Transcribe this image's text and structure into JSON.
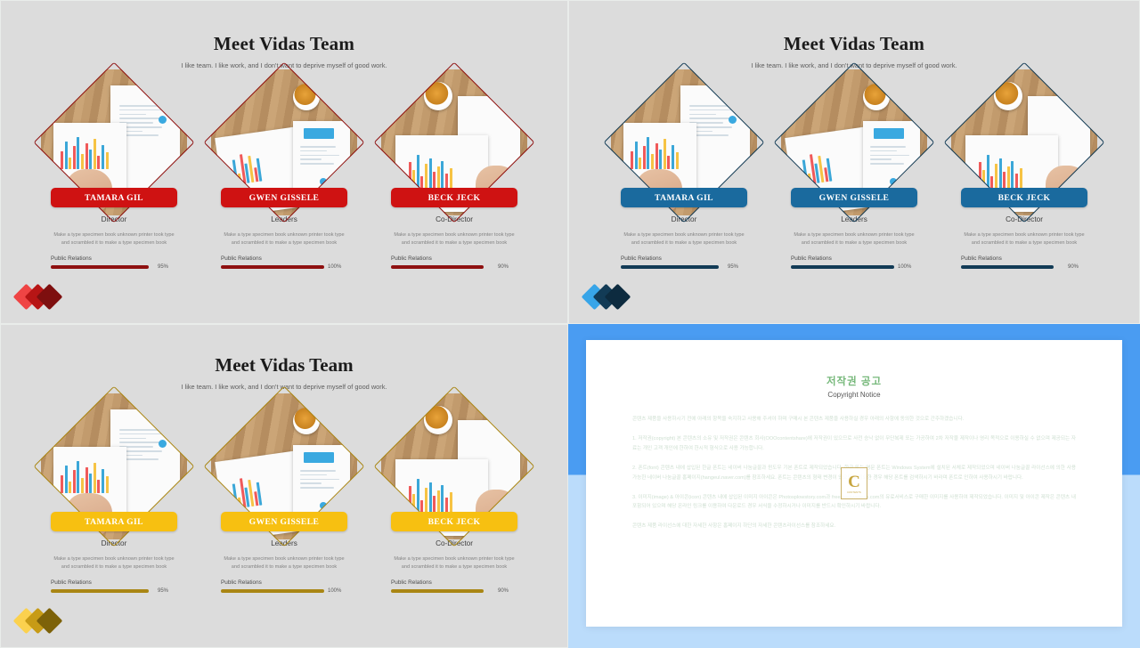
{
  "slides": [
    {
      "id": "red",
      "title": "Meet Vidas Team",
      "subtitle": "I like team. I like work, and I don't want to deprive myself of good work.",
      "accent": "#cf1212",
      "accent_dark": "#8e1010",
      "logo_colors": [
        "#ef4444",
        "#b71515",
        "#7e0f0f"
      ],
      "members": [
        {
          "name": "TAMARA GIL",
          "role": "Director",
          "bio": "Make a type specimen book unknown printer took type and scrambled it to make a type specimen book",
          "skill_label": "Public Relations",
          "skill_percent": "95%",
          "skill_value": 95,
          "photo": "desk-chart-finger"
        },
        {
          "name": "GWEN GISSELE",
          "role": "Leaders",
          "bio": "Make a type specimen book unknown printer took type and scrambled it to make a type specimen book",
          "skill_label": "Public Relations",
          "skill_percent": "100%",
          "skill_value": 100,
          "photo": "desk-chart-coffee-angled"
        },
        {
          "name": "BECK JECK",
          "role": "Co-Director",
          "bio": "Make a type specimen book unknown printer took type and scrambled it to make a type specimen book",
          "skill_label": "Public Relations",
          "skill_percent": "90%",
          "skill_value": 90,
          "photo": "desk-chart-coffee-hand"
        }
      ]
    },
    {
      "id": "blue",
      "title": "Meet Vidas Team",
      "subtitle": "I like team. I like work, and I don't want to deprive myself of good work.",
      "accent": "#1a6a9e",
      "accent_dark": "#123b56",
      "logo_colors": [
        "#38a5e8",
        "#123b56",
        "#0d2b3f"
      ],
      "members": [
        {
          "name": "TAMARA GIL",
          "role": "Director",
          "bio": "Make a type specimen book unknown printer took type and scrambled it to make a type specimen book",
          "skill_label": "Public Relations",
          "skill_percent": "95%",
          "skill_value": 95,
          "photo": "desk-chart-finger"
        },
        {
          "name": "GWEN GISSELE",
          "role": "Leaders",
          "bio": "Make a type specimen book unknown printer took type and scrambled it to make a type specimen book",
          "skill_label": "Public Relations",
          "skill_percent": "100%",
          "skill_value": 100,
          "photo": "desk-chart-coffee-angled"
        },
        {
          "name": "BECK JECK",
          "role": "Co-Director",
          "bio": "Make a type specimen book unknown printer took type and scrambled it to make a type specimen book",
          "skill_label": "Public Relations",
          "skill_percent": "90%",
          "skill_value": 90,
          "photo": "desk-chart-coffee-hand"
        }
      ]
    },
    {
      "id": "gold",
      "title": "Meet Vidas Team",
      "subtitle": "I like team. I like work, and I don't want to deprive myself of good work.",
      "accent": "#f7c011",
      "accent_dark": "#a98614",
      "logo_colors": [
        "#fbd14e",
        "#c79b16",
        "#7d6209"
      ],
      "members": [
        {
          "name": "TAMARA GIL",
          "role": "Director",
          "bio": "Make a type specimen book unknown printer took type and scrambled it to make a type specimen book",
          "skill_label": "Public Relations",
          "skill_percent": "95%",
          "skill_value": 95,
          "photo": "desk-chart-finger"
        },
        {
          "name": "GWEN GISSELE",
          "role": "Leaders",
          "bio": "Make a type specimen book unknown printer took type and scrambled it to make a type specimen book",
          "skill_label": "Public Relations",
          "skill_percent": "100%",
          "skill_value": 100,
          "photo": "desk-chart-coffee-angled"
        },
        {
          "name": "BECK JECK",
          "role": "Co-Director",
          "bio": "Make a type specimen book unknown printer took type and scrambled it to make a type specimen book",
          "skill_label": "Public Relations",
          "skill_percent": "90%",
          "skill_value": 90,
          "photo": "desk-chart-coffee-hand"
        }
      ]
    }
  ],
  "copyright": {
    "frame_color_top": "#4a9cf2",
    "frame_color_bottom": "#bbdcfb",
    "title_kr": "저작권 공고",
    "title_en": "Copyright Notice",
    "title_color": "#76b87a",
    "paragraphs": [
      "콘텐츠 제품을 사용하시기 전에 아래의 항목을 숙지하고 사용해 주셔야 하며 구매시 본 콘텐츠 제품을 사용하실 경우 아래의 사항에 동의한 것으로 간주하겠습니다.",
      "1. 저작권(copyright) 본 콘텐츠의 소유 및 저작권은 콘텐츠 회사(OOOcontentshare)에 저작권이 있으므로 사전 승낙 없이 무단복제 또는 가공하여 2차 저작물 제작이나 영리 목적으로 이용하실 수 없으며 제공되는 자료는 개인 고객 개인에 한하여 한시적 형식으로 사용 가능합니다.",
      "2. 폰트(font) 콘텐츠 내에 삽입된 한글 폰트는 네이버 나눔글꼴과 윈도우 기본 폰트로 제작되었습니다. 한글 또는 영문 폰트는 Windows System에 설치된 서체로 제작되었으며 네이버 나눔글꼴 라이선스에 의한 사용 가능한 네이버 나눔글꼴 홈페이지(hangeul.naver.com)를 참조하세요. 폰트는 콘텐츠의 형태 변경이 있으므로 필요한 경우 해당 폰트를 검색하시기 바라며 폰트로 인하여 사용하시기 바랍니다.",
      "3. 이미지(image) & 아이콘(icon) 콘텐츠 내에 삽입된 이미지 아이콘은 Photosplowstory.com과 freestockwebsys.com의 유료서비스로 구매한 이미지를 사용하여 제작되었습니다. 이미지 및 아이콘 제작은 콘텐츠 내 포함되어 있으며 해당 온라인 링크를 이용하여 다운로드 경우 서식을 수정하시거나 이미지를 반드시 확인하시기 바랍니다.",
      "콘텐츠 제품 라이선스에 대한 자세한 사항은 홈페이지 하단의 자세한 콘텐츠라이선스를 참조하세요."
    ],
    "watermark_letter": "C",
    "watermark_text": "CONTENTS"
  }
}
